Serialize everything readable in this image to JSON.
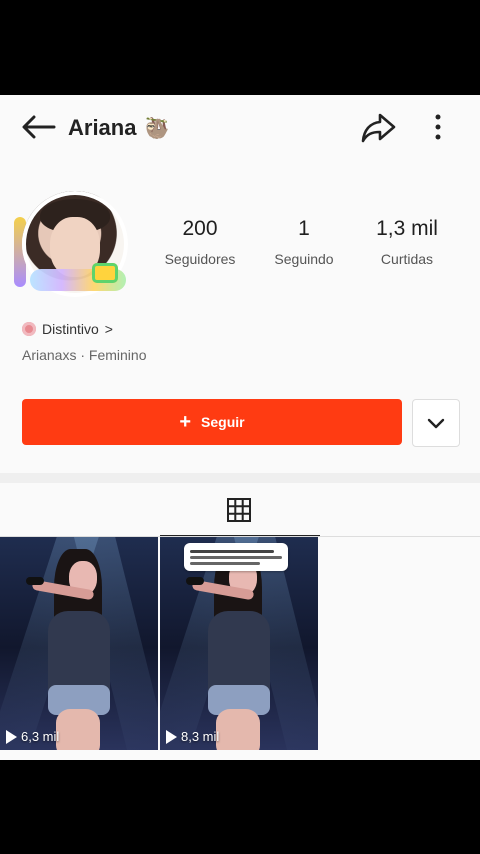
{
  "header": {
    "title": "Ariana",
    "title_emoji": "🦥"
  },
  "profile": {
    "stats": [
      {
        "value": "200",
        "label": "Seguidores"
      },
      {
        "value": "1",
        "label": "Seguindo"
      },
      {
        "value": "1,3 mil",
        "label": "Curtidas"
      }
    ],
    "badge_label": "Distintivo",
    "badge_suffix": ">",
    "meta": "Arianaxs · Feminino"
  },
  "actions": {
    "follow_label": "Seguir"
  },
  "videos": [
    {
      "views": "6,3 mil"
    },
    {
      "views": "8,3 mil"
    }
  ],
  "colors": {
    "accent": "#ff3b12"
  },
  "icons": {
    "back": "arrow-left-icon",
    "share": "share-icon",
    "more": "more-vertical-icon",
    "dropdown": "chevron-down-icon",
    "grid": "grid-icon",
    "play": "play-icon"
  }
}
